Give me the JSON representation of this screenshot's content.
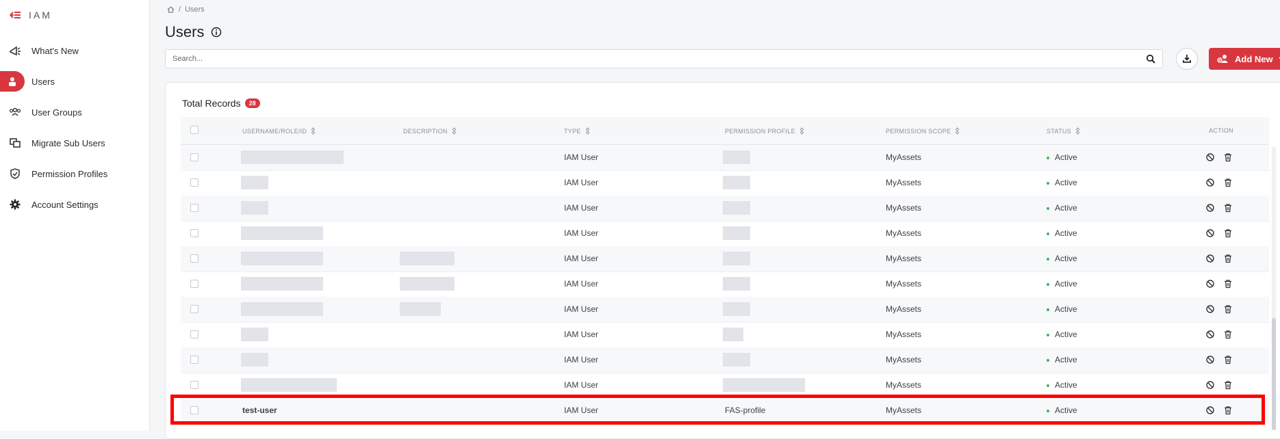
{
  "sidebar": {
    "brand": "IAM",
    "items": [
      {
        "label": "What's New",
        "icon": "megaphone-icon"
      },
      {
        "label": "Users",
        "icon": "user-badge-icon",
        "active": true
      },
      {
        "label": "User Groups",
        "icon": "users-group-icon"
      },
      {
        "label": "Migrate Sub Users",
        "icon": "migrate-icon"
      },
      {
        "label": "Permission Profiles",
        "icon": "shield-icon"
      },
      {
        "label": "Account Settings",
        "icon": "gear-icon"
      }
    ]
  },
  "breadcrumb": {
    "home_icon": "home-icon",
    "separator": "/",
    "current": "Users"
  },
  "page": {
    "title": "Users"
  },
  "search": {
    "placeholder": "Search..."
  },
  "toolbar": {
    "add_label": "Add New"
  },
  "records": {
    "label": "Total Records",
    "count": "28"
  },
  "table": {
    "headers": {
      "username": "USERNAME/ROLE/ID",
      "description": "DESCRIPTION",
      "type": "TYPE",
      "permission_profile": "PERMISSION PROFILE",
      "permission_scope": "PERMISSION SCOPE",
      "status": "STATUS",
      "action": "ACTION"
    },
    "rows": [
      {
        "username": "",
        "description": "",
        "type": "IAM User",
        "profile": "",
        "scope": "MyAssets",
        "status": "Active"
      },
      {
        "username": "",
        "description": "",
        "type": "IAM User",
        "profile": "",
        "scope": "MyAssets",
        "status": "Active"
      },
      {
        "username": "",
        "description": "",
        "type": "IAM User",
        "profile": "",
        "scope": "MyAssets",
        "status": "Active"
      },
      {
        "username": "",
        "description": "",
        "type": "IAM User",
        "profile": "",
        "scope": "MyAssets",
        "status": "Active"
      },
      {
        "username": "",
        "description": "",
        "type": "IAM User",
        "profile": "",
        "scope": "MyAssets",
        "status": "Active"
      },
      {
        "username": "",
        "description": "",
        "type": "IAM User",
        "profile": "",
        "scope": "MyAssets",
        "status": "Active"
      },
      {
        "username": "",
        "description": "",
        "type": "IAM User",
        "profile": "",
        "scope": "MyAssets",
        "status": "Active"
      },
      {
        "username": "",
        "description": "",
        "type": "IAM User",
        "profile": "",
        "scope": "MyAssets",
        "status": "Active"
      },
      {
        "username": "",
        "description": "",
        "type": "IAM User",
        "profile": "",
        "scope": "MyAssets",
        "status": "Active"
      },
      {
        "username": "",
        "description": "",
        "type": "IAM User",
        "profile": "",
        "scope": "MyAssets",
        "status": "Active"
      },
      {
        "username": "test-user",
        "description": "",
        "type": "IAM User",
        "profile": "FAS-profile",
        "scope": "MyAssets",
        "status": "Active",
        "highlighted": true
      }
    ]
  },
  "colors": {
    "accent": "#d9373f",
    "status_active": "#3fb55a",
    "highlight": "#ff0000"
  }
}
